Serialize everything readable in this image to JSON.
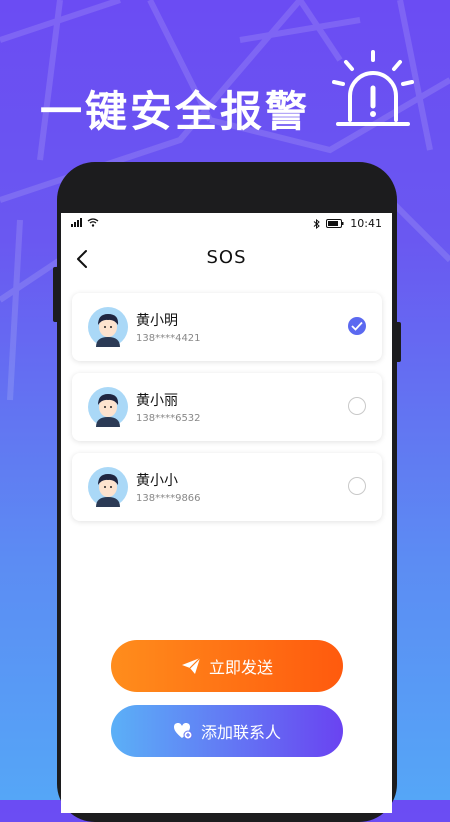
{
  "promo": {
    "headline": "一键安全报警",
    "alarm_icon": "alarm-light-icon"
  },
  "status_bar": {
    "time": "10:41",
    "icons": [
      "signal-icon",
      "wifi-icon",
      "bluetooth-icon",
      "battery-icon"
    ]
  },
  "nav": {
    "title": "SOS",
    "back_icon": "back-arrow-icon"
  },
  "contacts": [
    {
      "name": "黄小明",
      "phone": "138****4421",
      "selected": true
    },
    {
      "name": "黄小丽",
      "phone": "138****6532",
      "selected": false
    },
    {
      "name": "黄小小",
      "phone": "138****9866",
      "selected": false
    }
  ],
  "actions": {
    "send_label": "立即发送",
    "send_icon": "paper-plane-icon",
    "add_label": "添加联系人",
    "add_icon": "heart-add-icon"
  },
  "colors": {
    "background_top": "#6b4cf3",
    "background_bottom": "#55a6f7",
    "check_blue": "#5b69f0",
    "send_orange": "#ff6a12",
    "add_gradient": [
      "#5bb0f7",
      "#6a43f1"
    ]
  }
}
